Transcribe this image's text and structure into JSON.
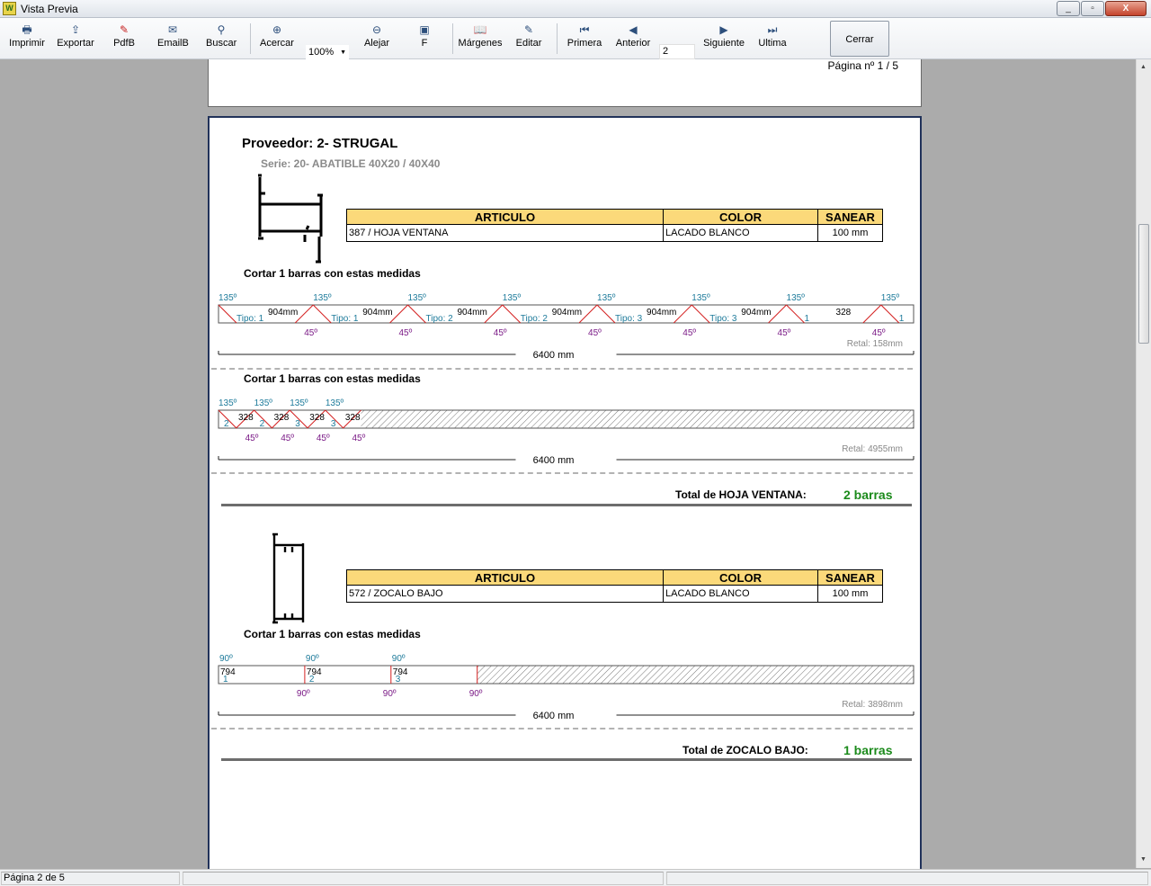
{
  "window": {
    "title": "Vista Previa",
    "btn_min": "_",
    "btn_max": "▫",
    "btn_close": "X"
  },
  "toolbar": {
    "imprimir": "Imprimir",
    "exportar": "Exportar",
    "pdfb": "PdfB",
    "emailb": "EmailB",
    "buscar": "Buscar",
    "acercar": "Acercar",
    "zoom": "100%",
    "alejar": "Alejar",
    "f": "F",
    "margenes": "Márgenes",
    "editar": "Editar",
    "primera": "Primera",
    "anterior": "Anterior",
    "page_value": "2",
    "siguiente": "Siguiente",
    "ultima": "Ultima",
    "cerrar": "Cerrar"
  },
  "page1": {
    "footer": "Página nº 1 / 5"
  },
  "report": {
    "proveedor": "Proveedor: 2- STRUGAL",
    "serie": "Serie: 20- ABATIBLE 40X20 / 40X40",
    "table_headers": {
      "articulo": "ARTICULO",
      "color": "COLOR",
      "sanear": "SANEAR"
    },
    "cortar_label": "Cortar 1 barras con estas medidas",
    "total_label": "Total de",
    "sections": [
      {
        "articulo": "387 / HOJA VENTANA",
        "color": "LACADO BLANCO",
        "sanear": "100 mm",
        "bars": [
          {
            "total": "6400 mm",
            "retal": "Retal: 158mm",
            "cuts": [
              {
                "len": "904mm",
                "tipo": "Tipo: 1",
                "top": "135º",
                "bot": "45º"
              },
              {
                "len": "904mm",
                "tipo": "Tipo: 1",
                "top": "135º",
                "bot": "45º"
              },
              {
                "len": "904mm",
                "tipo": "Tipo: 2",
                "top": "135º",
                "bot": "45º"
              },
              {
                "len": "904mm",
                "tipo": "Tipo: 2",
                "top": "135º",
                "bot": "45º"
              },
              {
                "len": "904mm",
                "tipo": "Tipo: 3",
                "top": "135º",
                "bot": "45º"
              },
              {
                "len": "904mm",
                "tipo": "Tipo: 3",
                "top": "135º",
                "bot": "45º"
              },
              {
                "len": "328",
                "tipo": "1",
                "top": "135º",
                "bot": "45º"
              },
              {
                "len": "328",
                "tipo": "1",
                "top": "135º",
                "bot": "45º"
              }
            ]
          },
          {
            "total": "6400 mm",
            "retal": "Retal: 4955mm",
            "cuts": [
              {
                "len": "328",
                "tipo": "2",
                "top": "135º",
                "bot": "45º"
              },
              {
                "len": "328",
                "tipo": "2",
                "top": "135º",
                "bot": "45º"
              },
              {
                "len": "328",
                "tipo": "3",
                "top": "135º",
                "bot": "45º"
              },
              {
                "len": "328",
                "tipo": "3",
                "top": "135º",
                "bot": "45º"
              }
            ]
          }
        ],
        "total_name": "HOJA VENTANA:",
        "total_value": "2 barras"
      },
      {
        "articulo": "572 / ZOCALO BAJO",
        "color": "LACADO BLANCO",
        "sanear": "100 mm",
        "bars": [
          {
            "total": "6400 mm",
            "retal": "Retal: 3898mm",
            "cuts": [
              {
                "len": "794",
                "tipo": "1",
                "top": "90º",
                "bot": "90º"
              },
              {
                "len": "794",
                "tipo": "2",
                "top": "90º",
                "bot": "90º"
              },
              {
                "len": "794",
                "tipo": "3",
                "top": "90º",
                "bot": "90º"
              }
            ]
          }
        ],
        "total_name": "ZOCALO BAJO:",
        "total_value": "1 barras"
      }
    ]
  },
  "status": {
    "page": "Página 2 de 5"
  },
  "colors": {
    "teal": "#1e7b9b",
    "purple": "#7a1a86",
    "green": "#1b8a1b",
    "red": "#d42020",
    "header_fill": "#fbd97a"
  }
}
